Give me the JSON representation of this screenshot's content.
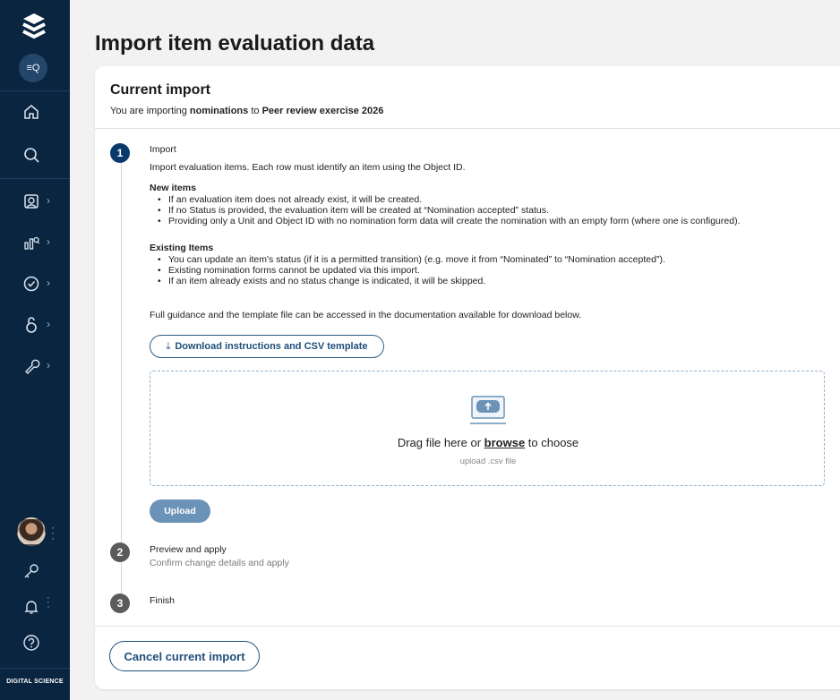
{
  "sidebar": {
    "search_label": "≡Q",
    "brand": "DIGITAL SCIENCE"
  },
  "page": {
    "title": "Import item evaluation data"
  },
  "card": {
    "title": "Current import",
    "subtitle_prefix": "You are importing ",
    "subtitle_bold": "nominations",
    "subtitle_mid": " to ",
    "subtitle_target": "Peer review exercise 2026"
  },
  "steps": [
    {
      "number": "1",
      "title": "Import"
    },
    {
      "number": "2",
      "title": "Preview and apply",
      "subtitle": "Confirm change details and apply"
    },
    {
      "number": "3",
      "title": "Finish"
    }
  ],
  "import_step": {
    "intro": "Import evaluation items. Each row must identify an item using the Object ID.",
    "new_heading": "New items",
    "new_items": [
      "If an evaluation item does not already exist, it will be created.",
      "If no Status is provided, the evaluation item will be created at “Nomination accepted” status.",
      "Providing only a Unit and Object ID with no nomination form data will create the nomination with an empty form (where one is configured)."
    ],
    "existing_heading": "Existing Items",
    "existing_items": [
      "You can update an item's status (if it is a permitted transition) (e.g. move it from “Nominated” to “Nomination accepted”).",
      "Existing nomination forms cannot be updated via this import.",
      "If an item already exists and no status change is indicated, it will be skipped."
    ],
    "guidance": "Full guidance and the template file can be accessed in the documentation available for download below.",
    "download_label": "Download instructions and CSV template",
    "drop_prefix": "Drag file here or ",
    "drop_link": "browse",
    "drop_suffix": " to choose",
    "drop_hint": "upload .csv file",
    "upload_label": "Upload"
  },
  "cancel_label": "Cancel current import",
  "colors": {
    "sidebar": "#0a2540",
    "accent": "#1f4e7a",
    "step_active": "#0a3a6b"
  }
}
